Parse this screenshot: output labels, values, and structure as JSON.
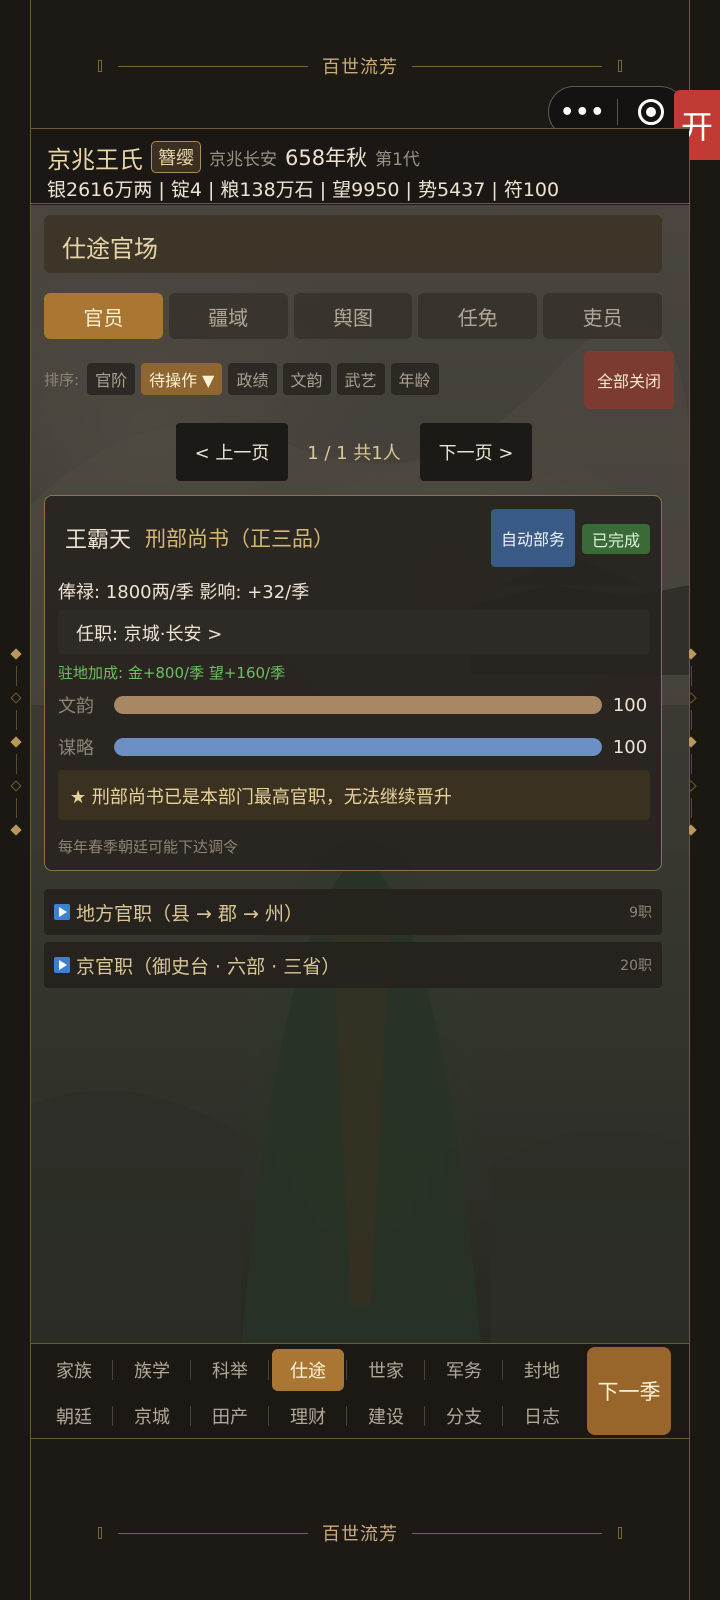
{
  "banner": {
    "top": "百世流芳",
    "bottom": "百世流芳"
  },
  "capsule": {
    "more_icon": "•••",
    "red_tag": "开"
  },
  "header": {
    "clan_name": "京兆王氏",
    "rank_badge": "簪缨",
    "location": "京兆长安",
    "year": "658年秋",
    "generation": "第1代",
    "resources": "银2616万两 | 锭4 | 粮138万石 | 望9950 | 势5437 | 符100"
  },
  "section": {
    "title": "仕途官场"
  },
  "tabs": [
    {
      "label": "官员",
      "active": true
    },
    {
      "label": "疆域"
    },
    {
      "label": "舆图"
    },
    {
      "label": "任免"
    },
    {
      "label": "吏员"
    }
  ],
  "sort": {
    "label": "排序:",
    "chips": [
      {
        "label": "官阶"
      },
      {
        "label": "待操作 ▼",
        "active": true
      },
      {
        "label": "政绩"
      },
      {
        "label": "文韵"
      },
      {
        "label": "武艺"
      },
      {
        "label": "年龄"
      }
    ],
    "close_all": "全部关闭"
  },
  "pager": {
    "prev": "< 上一页",
    "info": "1 / 1  共1人",
    "next": "下一页 >"
  },
  "official": {
    "name": "王霸天",
    "title": "刑部尚书（正三品）",
    "auto_button": "自动部务",
    "status_badge": "已完成",
    "salary": "俸禄: 1800两/季   影响: +32/季",
    "post": "任职: 京城·长安  >",
    "bonus": "驻地加成: 金+800/季  望+160/季",
    "stats": [
      {
        "label": "文韵",
        "value": "100",
        "level": 1.0,
        "color": "#a88864"
      },
      {
        "label": "谋略",
        "value": "100",
        "level": 1.0,
        "color": "#6c8fc4"
      }
    ],
    "notice": "★ 刑部尚书已是本部门最高官职，无法继续晋升",
    "footnote": "每年春季朝廷可能下达调令"
  },
  "groups": [
    {
      "label": "地方官职（县 → 郡 → 州）",
      "count": "9职"
    },
    {
      "label": "京官职（御史台 · 六部 · 三省）",
      "count": "20职"
    }
  ],
  "nav": {
    "items": [
      {
        "label": "家族"
      },
      {
        "label": "族学"
      },
      {
        "label": "科举"
      },
      {
        "label": "仕途",
        "active": true
      },
      {
        "label": "世家"
      },
      {
        "label": "军务"
      },
      {
        "label": "封地"
      },
      {
        "label": "朝廷"
      },
      {
        "label": "京城"
      },
      {
        "label": "田产"
      },
      {
        "label": "理财"
      },
      {
        "label": "建设"
      },
      {
        "label": "分支"
      },
      {
        "label": "日志"
      }
    ],
    "next_season": "下一季"
  }
}
